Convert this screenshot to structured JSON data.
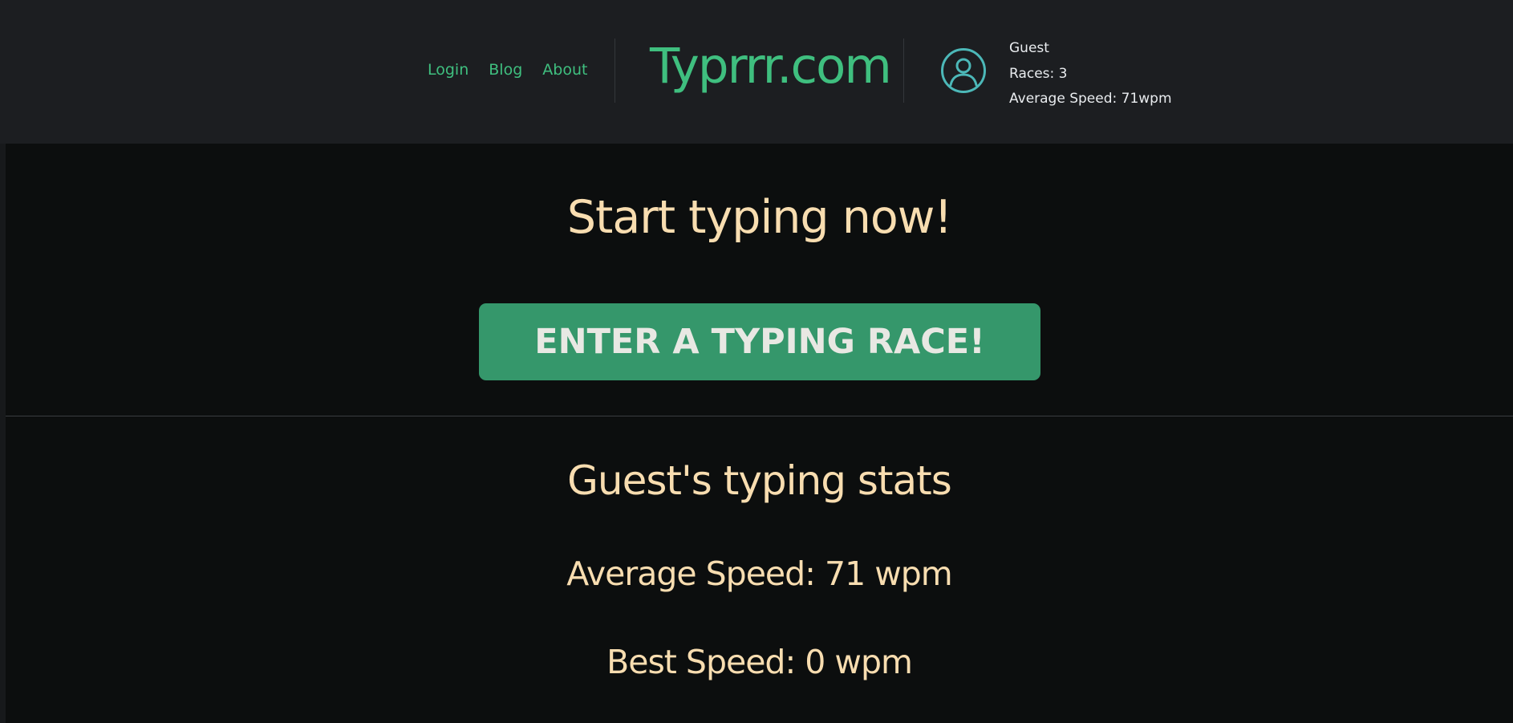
{
  "nav": {
    "login": "Login",
    "blog": "Blog",
    "about": "About"
  },
  "logo": "Typrrr.com",
  "user": {
    "name": "Guest",
    "races": "Races: 3",
    "avg_speed": "Average Speed: 71wpm",
    "icon": "user-circle-icon"
  },
  "hero": {
    "headline": "Start typing now!",
    "button_label": "ENTER A TYPING RACE!"
  },
  "stats": {
    "title": "Guest's typing stats",
    "average": "Average Speed: 71 wpm",
    "best": "Best Speed: 0 wpm"
  },
  "colors": {
    "accent_green": "#3fbf7f",
    "button_green": "#35976b",
    "cream_text": "#f8ddb0",
    "avatar_teal": "#4cb8b8",
    "header_bg": "#1c1e21",
    "page_bg": "#0c0e0e"
  }
}
